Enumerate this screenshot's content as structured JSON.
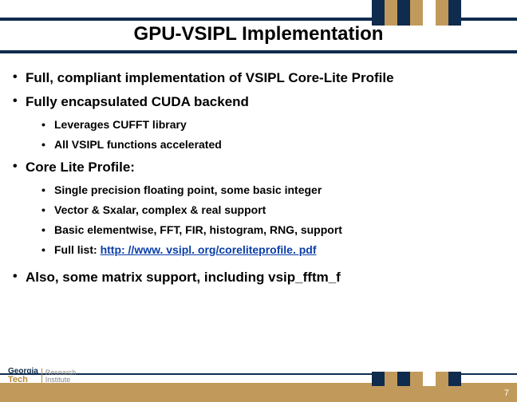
{
  "title": "GPU-VSIPL Implementation",
  "bullets": [
    {
      "text": "Full, compliant implementation of VSIPL Core-Lite Profile",
      "children": []
    },
    {
      "text": "Fully encapsulated CUDA backend",
      "children": [
        "Leverages CUFFT library",
        "All VSIPL functions accelerated"
      ]
    },
    {
      "text": "Core Lite Profile:",
      "children": [
        "Single precision floating point, some basic integer",
        "Vector & Sxalar, complex & real support",
        "Basic elementwise, FFT, FIR, histogram, RNG, support"
      ],
      "link_child": {
        "prefix": "Full list: ",
        "link_text": "http: //www. vsipl. org/coreliteprofile. pdf"
      }
    },
    {
      "text": "Also, some matrix support, including vsip_fftm_f",
      "children": []
    }
  ],
  "page_number": "7",
  "logo": {
    "line1": "Georgia",
    "line2": "Tech",
    "research": "Research",
    "institute": "Institute"
  },
  "colors": {
    "navy": "#0f2b4d",
    "gold": "#c19a5b"
  }
}
